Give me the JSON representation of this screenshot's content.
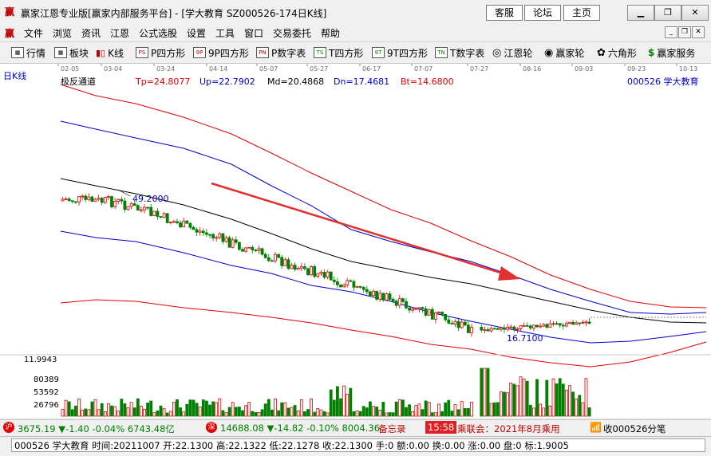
{
  "window": {
    "title": "赢家江恩专业版[赢家内部服务平台] - [学大教育   SZ000526-174日K线]",
    "links": [
      "客服",
      "论坛",
      "主页"
    ]
  },
  "menu": [
    "文件",
    "浏览",
    "资讯",
    "江恩",
    "公式选股",
    "设置",
    "工具",
    "窗口",
    "交易委托",
    "帮助"
  ],
  "toolbar": [
    {
      "icon": "table-icon",
      "label": "行情"
    },
    {
      "icon": "grid-icon",
      "label": "板块"
    },
    {
      "icon": "candlestick-icon",
      "label": "K线"
    },
    {
      "icon": "ps-icon",
      "label": "P四方形"
    },
    {
      "icon": "9p-icon",
      "label": "9P四方形"
    },
    {
      "icon": "pn-icon",
      "label": "P数字表"
    },
    {
      "icon": "ts-icon",
      "label": "T四方形"
    },
    {
      "icon": "9t-icon",
      "label": "9T四方形"
    },
    {
      "icon": "tn-icon",
      "label": "T数字表"
    },
    {
      "icon": "wheel-icon",
      "label": "江恩轮"
    },
    {
      "icon": "big-icon",
      "label": "赢家轮"
    },
    {
      "icon": "hexagon-icon",
      "label": "六角形"
    },
    {
      "icon": "dollar-icon",
      "label": "赢家服务"
    }
  ],
  "chart_header": {
    "period": "日K线",
    "indicator": "极反通道",
    "tp": "Tp=24.8077",
    "up": "Up=22.7902",
    "md": "Md=20.4868",
    "dn": "Dn=17.4681",
    "bt": "Bt=14.6800",
    "symbol": "000526  学大教育"
  },
  "date_ticks": [
    "02-05",
    "03-04",
    "03-24",
    "04-14",
    "05-07",
    "05-27",
    "06-17",
    "07-07",
    "07-27",
    "08-16",
    "09-03",
    "09-23",
    "10-13"
  ],
  "annotations": {
    "high": "49.2000",
    "low": "16.7100",
    "price_axis": "11.9943",
    "vol_ticks": [
      "80389",
      "53592",
      "26796"
    ]
  },
  "chart_data": {
    "type": "candlestick",
    "series": [
      {
        "name": "Tp",
        "color": "#e00000"
      },
      {
        "name": "Up",
        "color": "#0000cc"
      },
      {
        "name": "Md",
        "color": "#000000"
      },
      {
        "name": "Dn",
        "color": "#0000cc"
      },
      {
        "name": "Bt",
        "color": "#e00000"
      }
    ],
    "colors": {
      "up": "#e00000",
      "down": "#008000",
      "arrow": "#e03030"
    }
  },
  "status": {
    "sh_index": "3675.19",
    "sh_change": "▼-1.40",
    "sh_pct": "-0.04%",
    "sh_amount": "6743.48亿",
    "sz_index": "14688.08",
    "sz_change": "▼-14.82",
    "sz_pct": "-0.10%",
    "sz_amount": "8004.36",
    "memo": "备忘录",
    "time": "15:58",
    "ticker": "乘联会：2021年8月乘用",
    "receive": "收000526分笔"
  },
  "infobar": "000526 学大教育 时间:20211007 开:22.1300 高:22.1322 低:22.1278 收:22.1300 手:0 额:0.00 换:0.00 涨:0.00 盘:0 标:1.9005"
}
